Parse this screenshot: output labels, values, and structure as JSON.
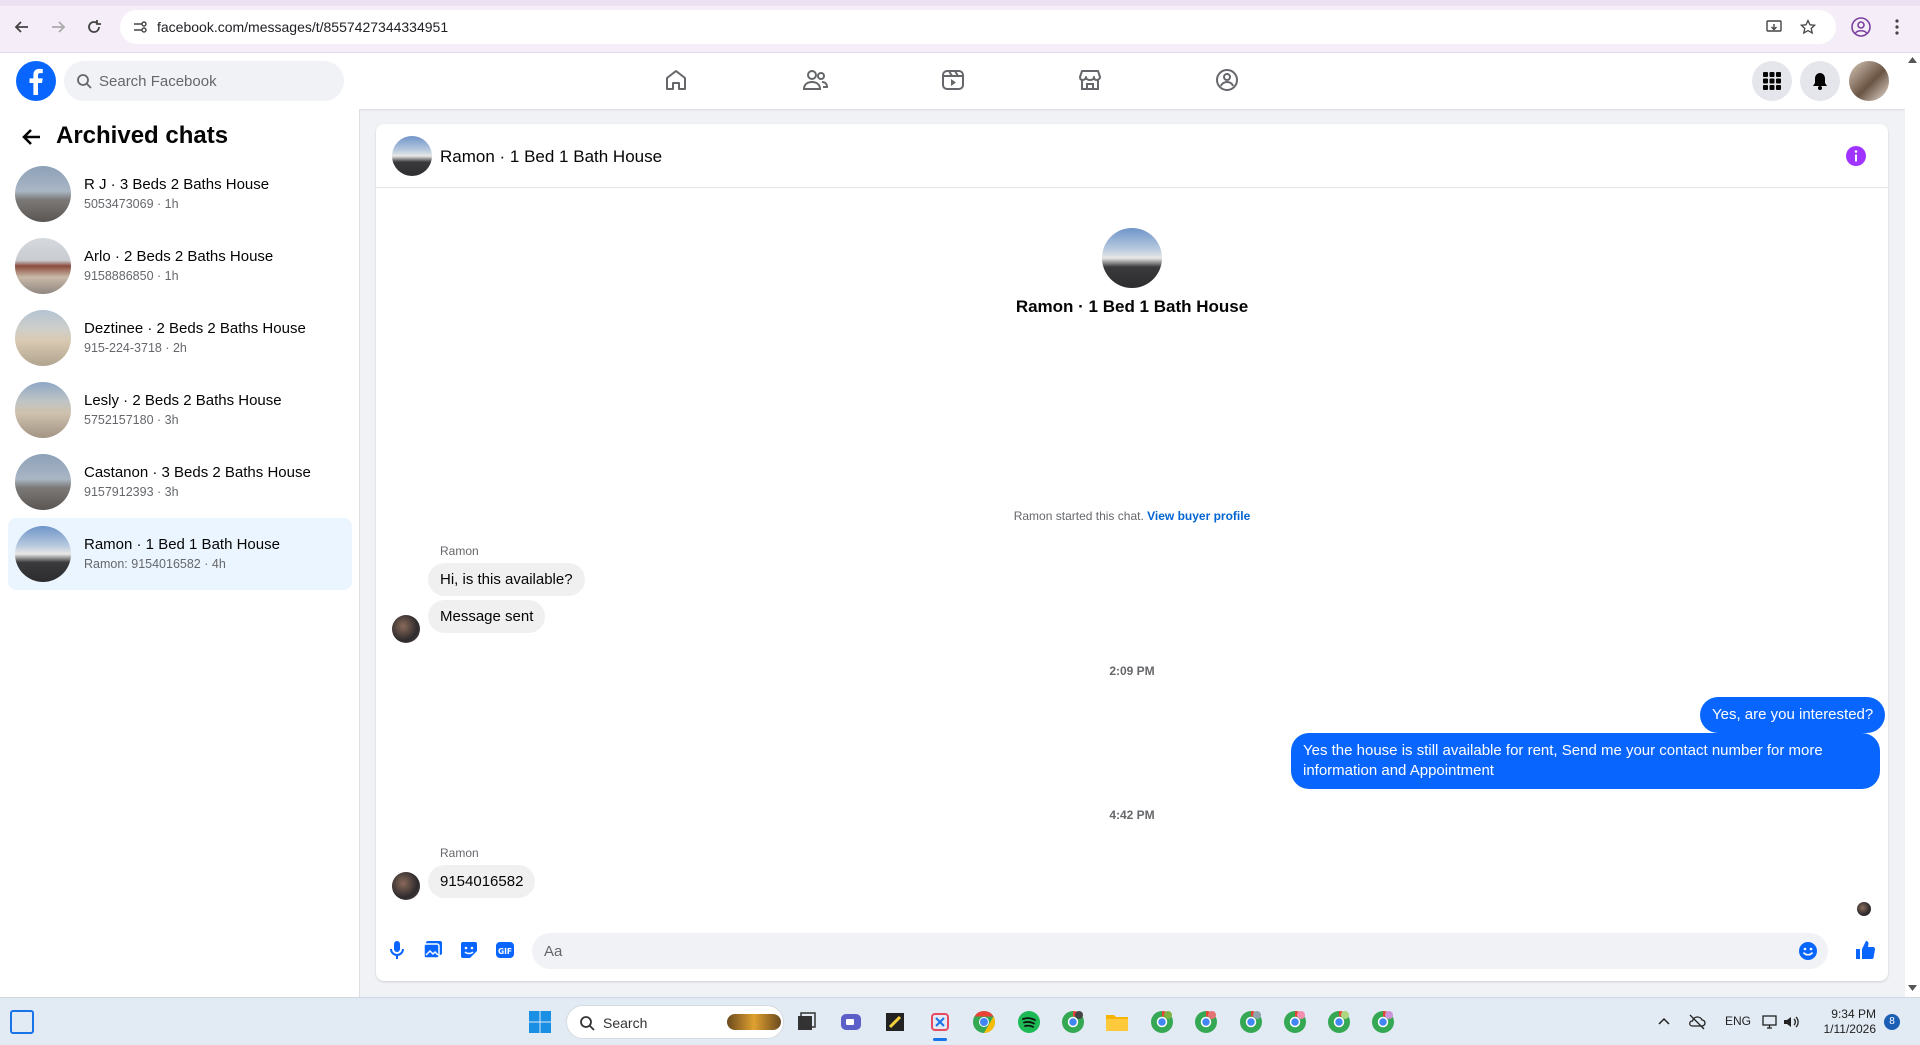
{
  "browser": {
    "url": "facebook.com/messages/t/8557427344334951"
  },
  "facebook": {
    "search_placeholder": "Search Facebook"
  },
  "sidebar": {
    "title": "Archived chats",
    "chats": [
      {
        "name": "R J · 3 Beds 2 Baths House",
        "sub": "5053473069 · 1h",
        "active": false
      },
      {
        "name": "Arlo · 2 Beds 2 Baths House",
        "sub": "9158886850 · 1h",
        "active": false
      },
      {
        "name": "Deztinee · 2 Beds 2 Baths House",
        "sub": "915-224-3718 · 2h",
        "active": false
      },
      {
        "name": "Lesly · 2 Beds 2 Baths House",
        "sub": "5752157180 · 3h",
        "active": false
      },
      {
        "name": "Castanon · 3 Beds 2 Baths House",
        "sub": "9157912393 · 3h",
        "active": false
      },
      {
        "name": "Ramon · 1 Bed 1 Bath House",
        "sub": "Ramon: 9154016582 · 4h",
        "active": true
      }
    ]
  },
  "conversation": {
    "title": "Ramon · 1 Bed 1 Bath House",
    "profile_name": "Ramon · 1 Bed 1 Bath House",
    "started_text": "Ramon started this chat.",
    "started_link": "View buyer profile",
    "messages": [
      {
        "sender": "Ramon",
        "text": "Hi, is this available?"
      },
      {
        "text": "Message sent"
      },
      {
        "timestamp": "2:09 PM"
      },
      {
        "text": "Yes, are you interested?"
      },
      {
        "text": "Yes the house is still available for rent, Send me your contact number for more information and Appointment"
      },
      {
        "timestamp": "4:42 PM"
      },
      {
        "sender": "Ramon",
        "text": "9154016582"
      }
    ],
    "composer_placeholder": "Aa"
  },
  "taskbar": {
    "search_label": "Search",
    "language": "ENG",
    "time": "9:34 PM",
    "date": "1/11/2026",
    "notification_count": "8"
  },
  "colors": {
    "brand_blue": "#0866ff",
    "link_blue": "#0064d1",
    "info_purple": "#a033ff",
    "active_chat_bg": "#ebf5ff"
  }
}
